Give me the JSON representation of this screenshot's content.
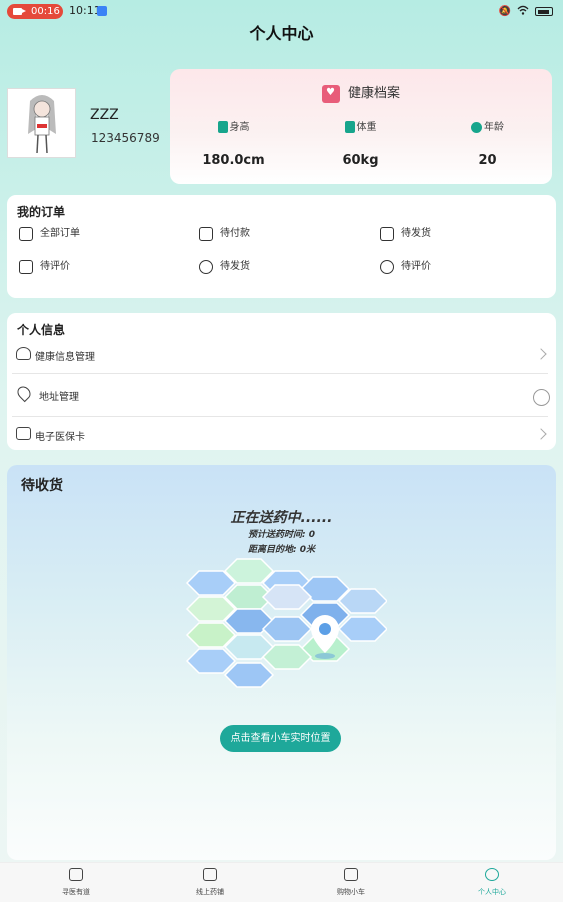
{
  "status_bar": {
    "recording": "00:16",
    "time": "10:11"
  },
  "page_title": "个人中心",
  "profile": {
    "name": "ZZZ",
    "id": "123456789"
  },
  "health": {
    "title": "健康档案",
    "height_label": "身高",
    "height_value": "180.0cm",
    "weight_label": "体重",
    "weight_value": "60kg",
    "age_label": "年龄",
    "age_value": "20"
  },
  "orders": {
    "title": "我的订单",
    "items": [
      {
        "label": "全部订单"
      },
      {
        "label": "待付款"
      },
      {
        "label": "待发货"
      },
      {
        "label": "待评价"
      },
      {
        "label": "待发货"
      },
      {
        "label": "待评价"
      }
    ]
  },
  "personal": {
    "title": "个人信息",
    "items": [
      {
        "label": "健康信息管理"
      },
      {
        "label": "地址管理"
      },
      {
        "label": "电子医保卡"
      }
    ]
  },
  "delivery": {
    "title": "待收货",
    "status": "正在送药中......",
    "eta": "预计送药时间: 0",
    "distance": "距离目的地: 0米",
    "button": "点击查看小车实时位置"
  },
  "tabbar": {
    "items": [
      {
        "label": "寻医有道"
      },
      {
        "label": "线上药铺"
      },
      {
        "label": "购物小车"
      },
      {
        "label": "个人中心"
      }
    ],
    "active_color": "#1ea89a"
  }
}
